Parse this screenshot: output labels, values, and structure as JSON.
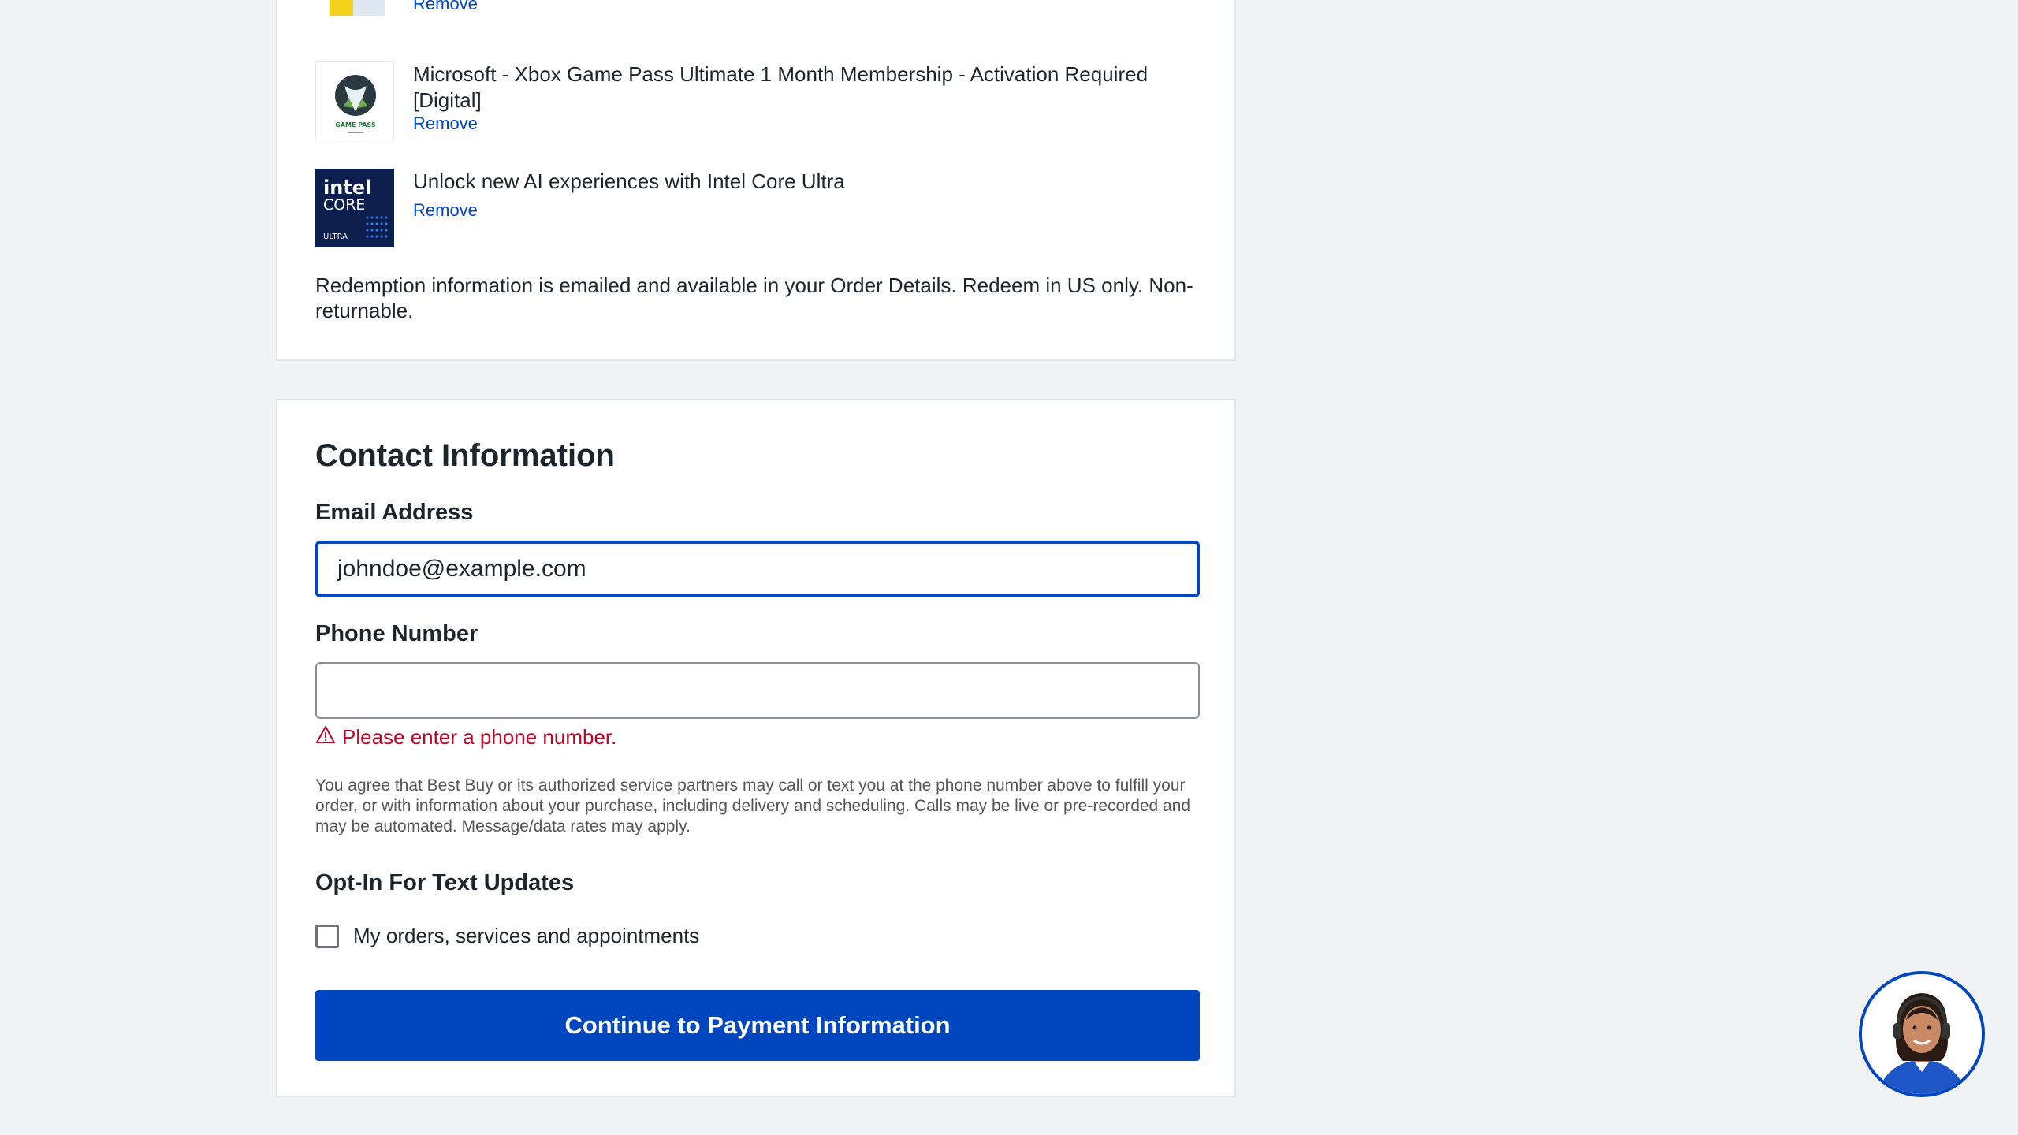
{
  "items": [
    {
      "title": "",
      "remove_label": "Remove",
      "thumb_icon": "gift-card-icon"
    },
    {
      "title": "Microsoft - Xbox Game Pass Ultimate 1 Month Membership - Activation Required [Digital]",
      "remove_label": "Remove",
      "thumb_icon": "xbox-game-pass-icon",
      "thumb_text": "GAME PASS"
    },
    {
      "title": "Unlock new AI experiences with Intel Core Ultra",
      "remove_label": "Remove",
      "thumb_icon": "intel-core-ultra-icon",
      "thumb_text_1": "intel",
      "thumb_text_2": "CORE",
      "thumb_text_3": "ULTRA"
    }
  ],
  "redemption_note": "Redemption information is emailed and available in your Order Details. Redeem in US only. Non-returnable.",
  "contact": {
    "title": "Contact Information",
    "email_label": "Email Address",
    "email_value": "johndoe@example.com",
    "phone_label": "Phone Number",
    "phone_value": "",
    "phone_error": "Please enter a phone number.",
    "disclaimer": "You agree that Best Buy or its authorized service partners may call or text you at the phone number above to fulfill your order, or with information about your purchase, including delivery and scheduling. Calls may be live or pre-recorded and may be automated. Message/data rates may apply.",
    "optin_title": "Opt-In For Text Updates",
    "optin_label": "My orders, services and appointments",
    "optin_checked": false,
    "continue_label": "Continue to Payment Information"
  },
  "colors": {
    "accent": "#0046be",
    "error": "#bb0628",
    "page_bg": "#f0f2f4"
  },
  "chat": {
    "icon": "support-agent-avatar"
  }
}
